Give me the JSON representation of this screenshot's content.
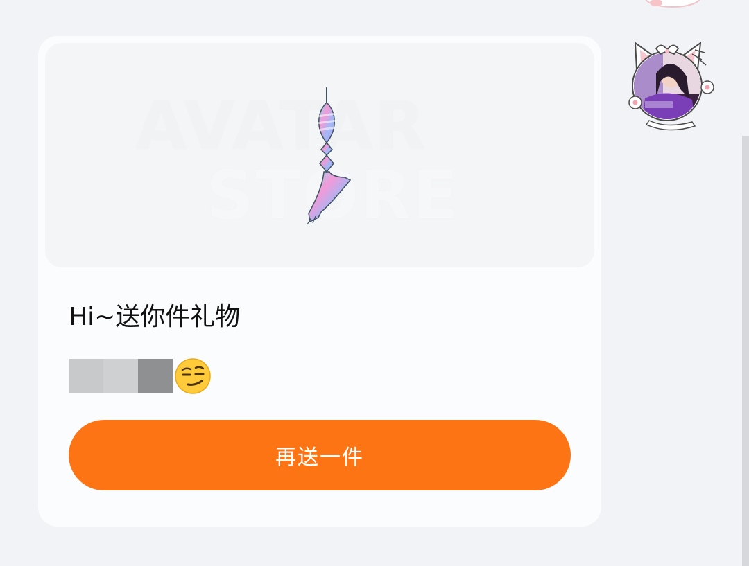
{
  "gift_card": {
    "preview": {
      "watermark_line1": "AVATAR",
      "watermark_line2": "STORE",
      "item_icon": "tassel-pendant-icon"
    },
    "greeting": "Hi~送你件礼物",
    "sender": {
      "name_censored": true,
      "emoji_icon": "smirking-face-emoji"
    },
    "resend_button_label": "再送一件"
  },
  "chat": {
    "avatar_icon": "cat-ear-avatar-frame-icon"
  },
  "colors": {
    "accent": "#fd7414",
    "background": "#f2f3f6",
    "card": "#fbfcfd"
  }
}
